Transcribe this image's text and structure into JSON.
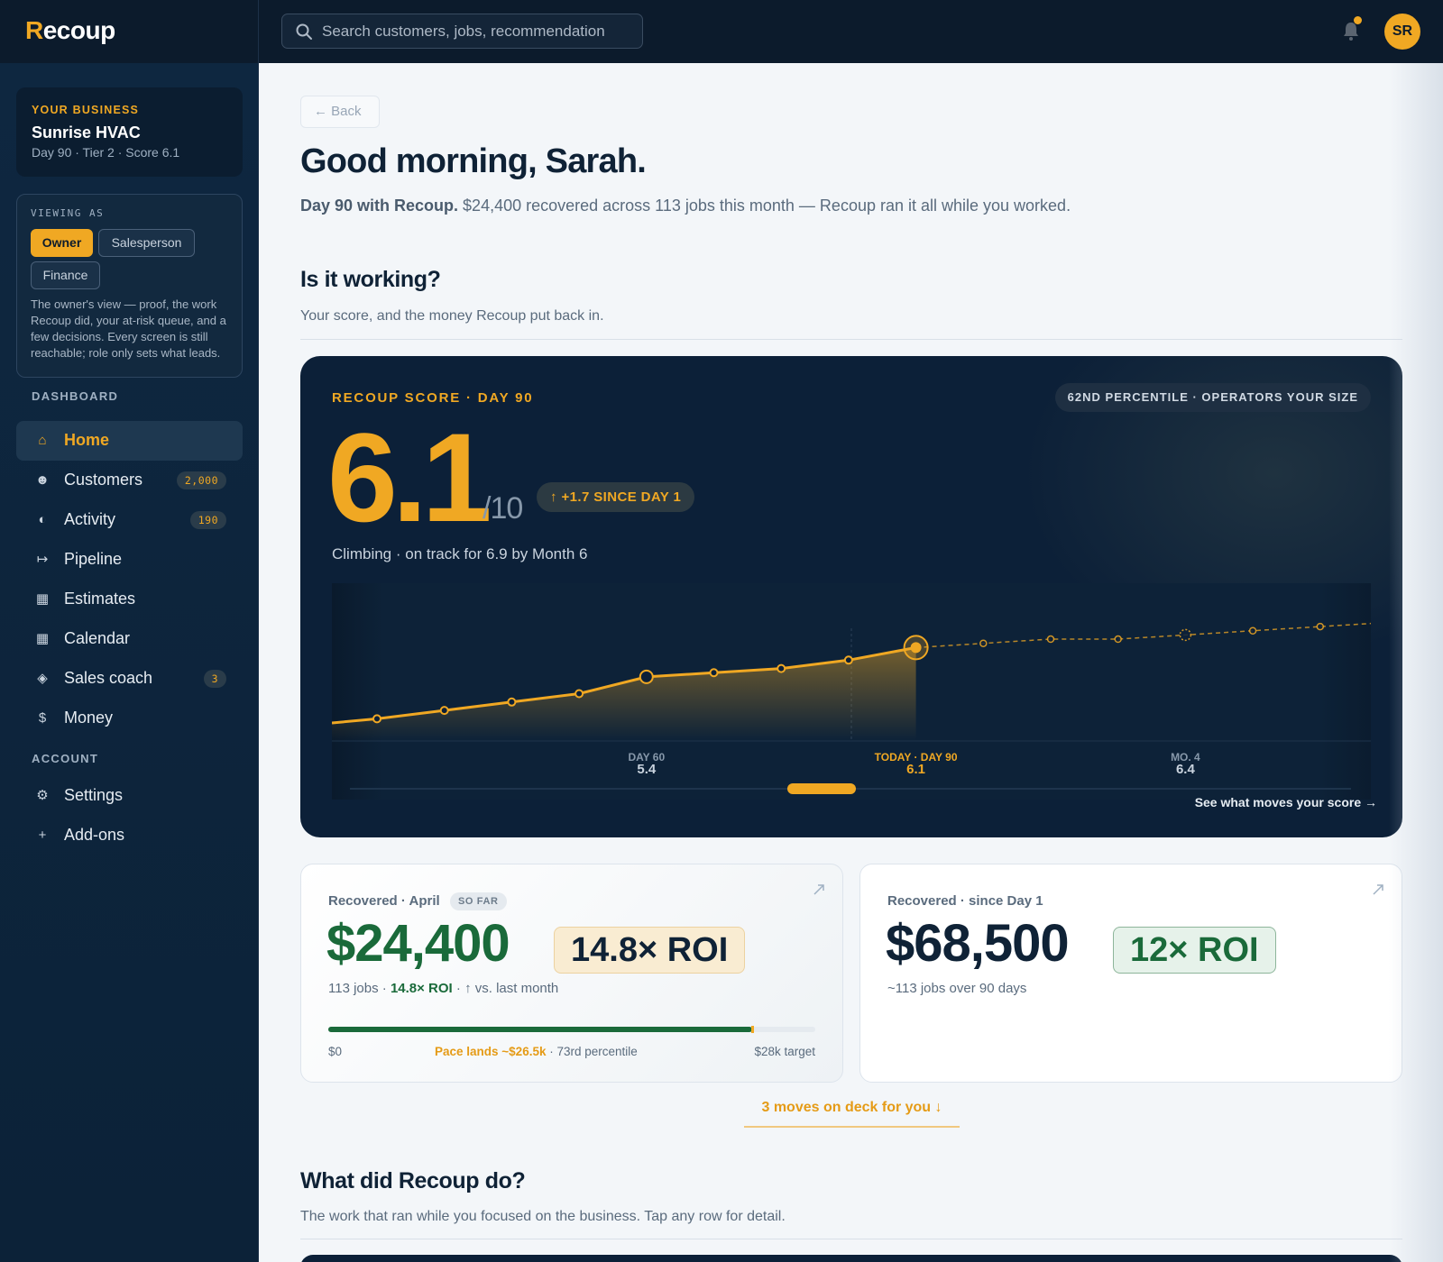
{
  "brand": {
    "lead": "R",
    "rest": "ecoup"
  },
  "search": {
    "placeholder": "Search customers, jobs, recommendation"
  },
  "user": {
    "initials": "SR"
  },
  "business": {
    "label": "YOUR BUSINESS",
    "name": "Sunrise HVAC",
    "meta": "Day 90 · Tier 2 · Score 6.1"
  },
  "viewing_as": {
    "label": "VIEWING AS",
    "roles": [
      "Owner",
      "Salesperson",
      "Finance"
    ],
    "selected": "Owner",
    "description": "The owner's view — proof, the work Recoup did, your at-risk queue, and a few decisions. Every screen is still reachable; role only sets what leads."
  },
  "nav": {
    "dashboard_label": "DASHBOARD",
    "account_label": "ACCOUNT",
    "items": [
      {
        "label": "Home",
        "icon": "home-icon",
        "glyph": "⌂",
        "badge": ""
      },
      {
        "label": "Customers",
        "icon": "users-icon",
        "glyph": "☻",
        "badge": "2,000"
      },
      {
        "label": "Activity",
        "icon": "activity-icon",
        "glyph": "◐",
        "badge": "190"
      },
      {
        "label": "Pipeline",
        "icon": "pipeline-icon",
        "glyph": "↦",
        "badge": ""
      },
      {
        "label": "Estimates",
        "icon": "estimates-icon",
        "glyph": "▦",
        "badge": ""
      },
      {
        "label": "Calendar",
        "icon": "calendar-icon",
        "glyph": "▦",
        "badge": ""
      },
      {
        "label": "Sales coach",
        "icon": "coach-icon",
        "glyph": "◈",
        "badge": "3"
      },
      {
        "label": "Money",
        "icon": "dollar-icon",
        "glyph": "$",
        "badge": ""
      }
    ],
    "account_items": [
      {
        "label": "Settings",
        "icon": "gear-icon",
        "glyph": "⚙"
      },
      {
        "label": "Add-ons",
        "icon": "plus-icon",
        "glyph": "+"
      }
    ]
  },
  "page": {
    "back_label": "Back",
    "greeting": "Good morning, Sarah.",
    "sub_bold": "Day 90 with Recoup.",
    "sub_rest": " $24,400 recovered across 113 jobs this month — Recoup ran it all while you worked."
  },
  "working": {
    "title": "Is it working?",
    "subtitle": "Your score, and the money Recoup put back in."
  },
  "score": {
    "kicker": "RECOUP SCORE · DAY 90",
    "percentile": "62ND PERCENTILE · OPERATORS YOUR SIZE",
    "value": "6.1",
    "denominator": "/10",
    "delta": "+1.7 SINCE DAY 1",
    "note": "Climbing · on track for 6.9 by Month 6",
    "see_moves": "See what moves your score →"
  },
  "chart_data": {
    "type": "line",
    "series": [
      {
        "values": [
          4.4,
          4.6,
          4.8,
          5.0,
          5.4,
          5.5,
          5.6,
          5.8,
          6.1
        ],
        "style": "solid"
      },
      {
        "values": [
          6.1,
          6.2,
          6.3,
          6.3,
          6.4,
          6.5,
          6.6,
          6.7
        ],
        "style": "dashed-projection"
      }
    ],
    "labels": [
      {
        "name": "DAY 60",
        "value": "5.4"
      },
      {
        "name": "TODAY · DAY 90",
        "value": "6.1"
      },
      {
        "name": "MO. 4",
        "value": "6.4"
      }
    ],
    "colors": {
      "line": "#f0a823",
      "background": "#0c2038"
    }
  },
  "recovered_month": {
    "label": "Recovered · April",
    "tag": "SO FAR",
    "value": "$24,400",
    "roi": "14.8× ROI",
    "meta_jobs": "113 jobs · ",
    "meta_roi": "14.8× ROI",
    "meta_rest": " · ↑ vs. last month",
    "progress_fraction": 0.87,
    "progress_left": "$0",
    "pace": "Pace lands ~$26.5k",
    "pace_rest": " · 73rd percentile",
    "progress_right": "$28k target"
  },
  "recovered_total": {
    "label": "Recovered · since Day 1",
    "value": "$68,500",
    "roi": "12× ROI",
    "meta": "~113 jobs over 90 days"
  },
  "moves": {
    "label": "3 moves on deck for you ↓"
  },
  "did": {
    "title": "What did Recoup do?",
    "subtitle": "The work that ran while you focused on the business. Tap any row for detail."
  }
}
